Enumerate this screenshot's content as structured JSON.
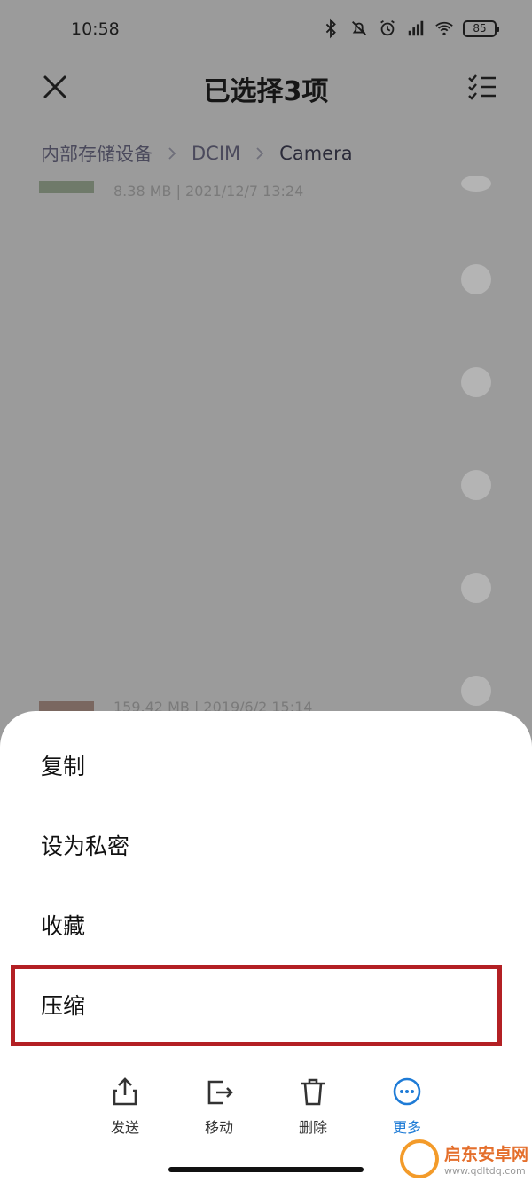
{
  "status_bar": {
    "time": "10:58",
    "battery": "85"
  },
  "header": {
    "title": "已选择3项"
  },
  "breadcrumb": [
    "内部存储设备",
    "DCIM",
    "Camera"
  ],
  "files": [
    {
      "meta": "8.38 MB  |  2021/12/7 13:24"
    },
    {
      "meta": "159.42 MB  |  2019/6/2 15:14"
    }
  ],
  "menu": {
    "items": [
      "复制",
      "设为私密",
      "收藏",
      "压缩"
    ]
  },
  "actions": [
    {
      "label": "发送",
      "icon": "share-icon"
    },
    {
      "label": "移动",
      "icon": "move-icon"
    },
    {
      "label": "删除",
      "icon": "trash-icon"
    },
    {
      "label": "更多",
      "icon": "more-icon"
    }
  ],
  "colors": {
    "accent": "#1e7bd6",
    "highlight": "#b32024",
    "overlay": "#9b9b9b"
  },
  "watermark": {
    "title": "启东安卓网",
    "url": "www.qdltdq.com"
  }
}
